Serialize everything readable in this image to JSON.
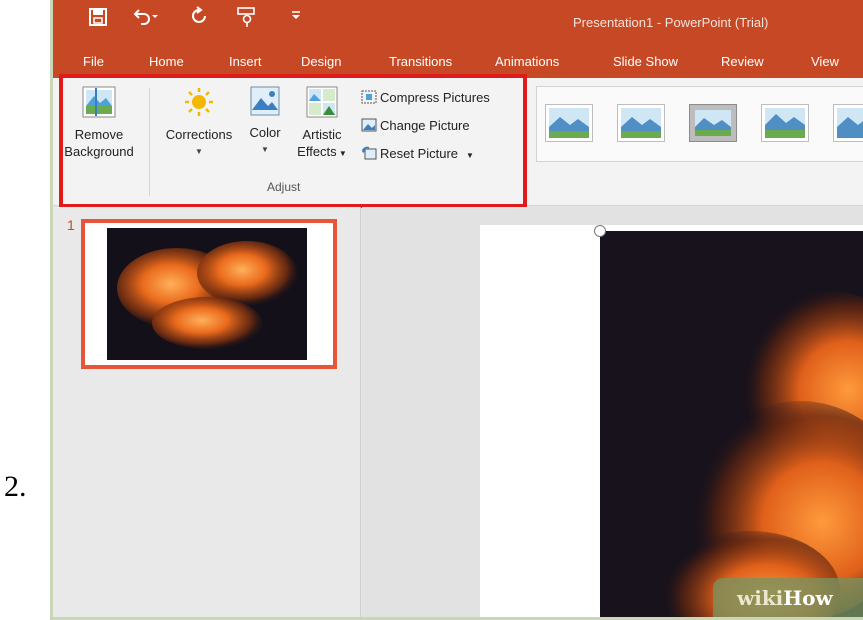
{
  "step_number": "2.",
  "titlebar": {
    "title": "Presentation1 - PowerPoint (Trial)",
    "icons": [
      "save-icon",
      "undo-icon",
      "redo-icon",
      "touch-mode-icon",
      "customize-qat-icon"
    ]
  },
  "tabs": [
    "File",
    "Home",
    "Insert",
    "Design",
    "Transitions",
    "Animations",
    "Slide Show",
    "Review",
    "View"
  ],
  "ribbon": {
    "remove_background": [
      "Remove",
      "Background"
    ],
    "corrections": "Corrections",
    "color": "Color",
    "artistic_effects": [
      "Artistic",
      "Effects"
    ],
    "compress_pictures": "Compress Pictures",
    "change_picture": "Change Picture",
    "reset_picture": "Reset Picture",
    "group_label": "Adjust"
  },
  "thumbnail": {
    "slide_number": "1"
  },
  "watermark": {
    "wiki": "wiki",
    "how": "How"
  },
  "colors": {
    "accent": "#c74824",
    "highlight": "#e01b1b",
    "thumb_border": "#e8533a"
  }
}
